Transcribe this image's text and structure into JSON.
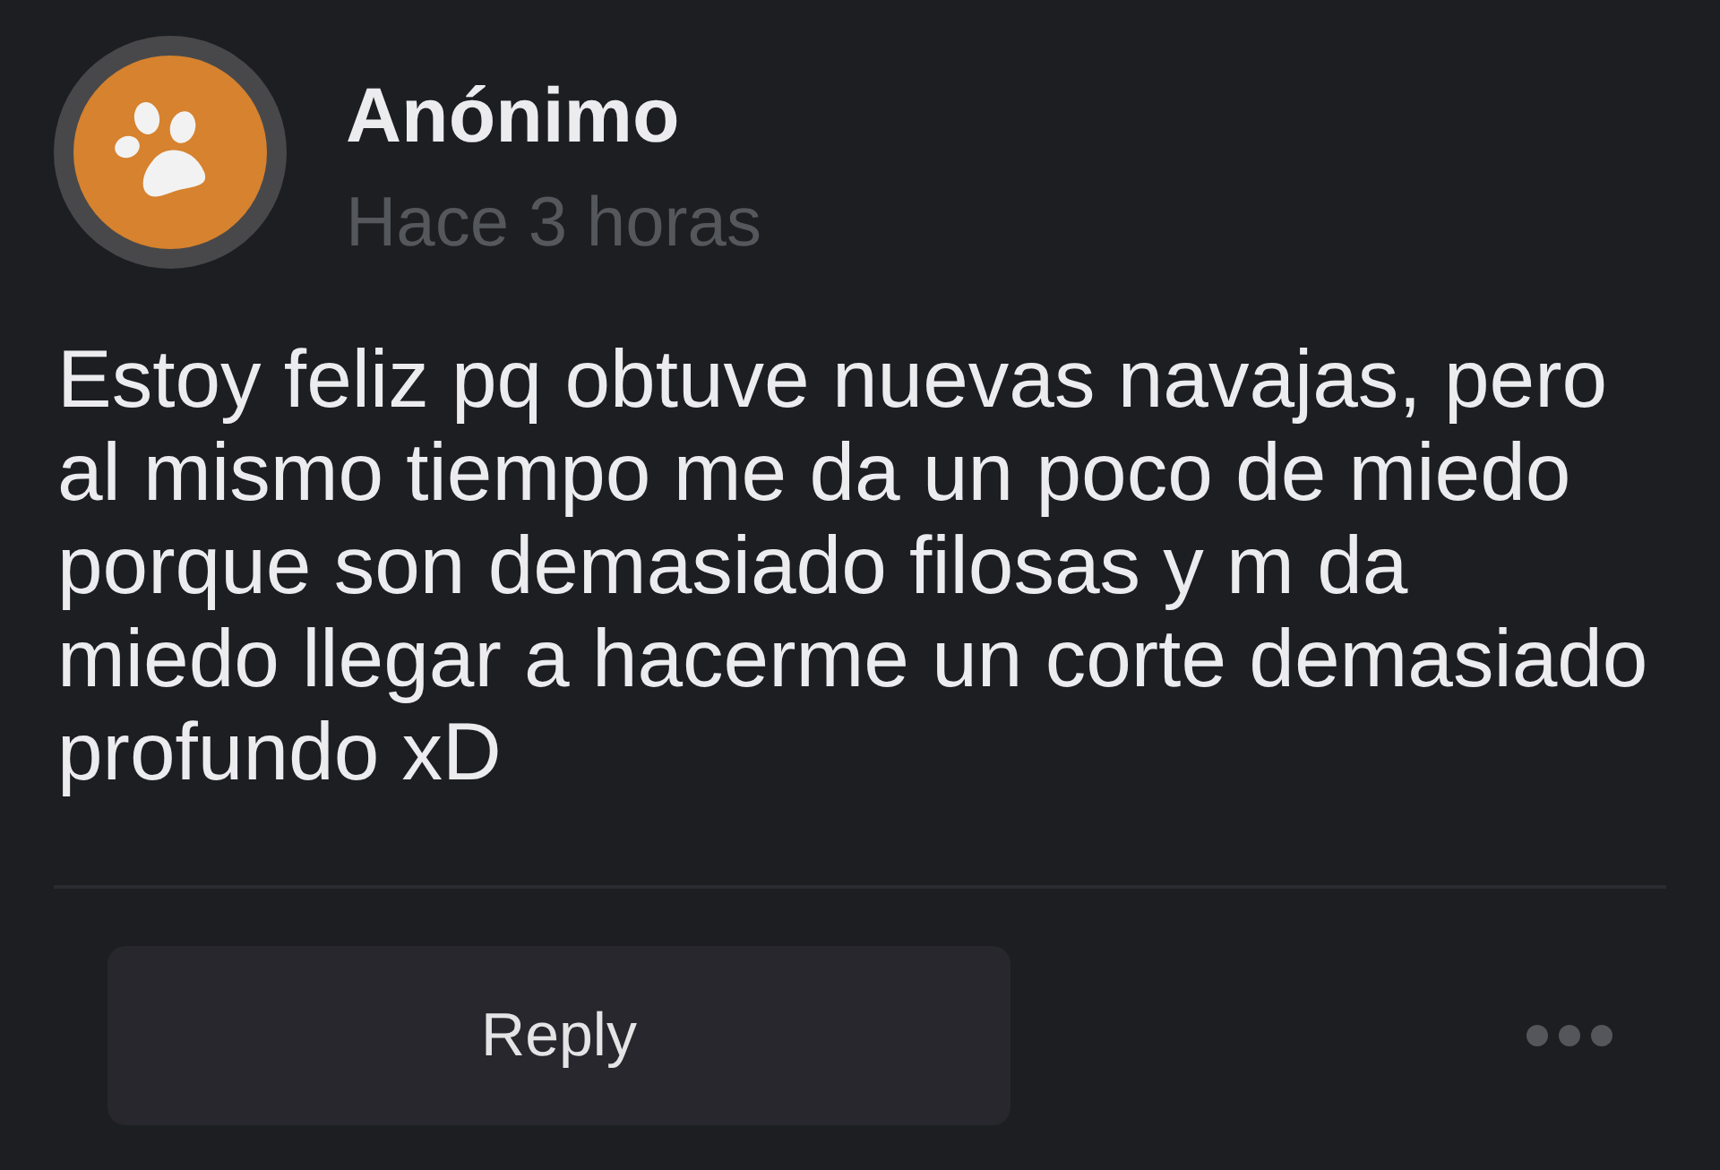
{
  "post": {
    "author": "Anónimo",
    "time": "Hace 3 horas",
    "body": "Estoy feliz pq obtuve nuevas navajas, pero al mismo tiempo me da un poco de miedo porque son demasiado filosas y m da\nmiedo llegar a hacerme un corte demasiado profundo xD"
  },
  "actions": {
    "reply": "Reply"
  }
}
